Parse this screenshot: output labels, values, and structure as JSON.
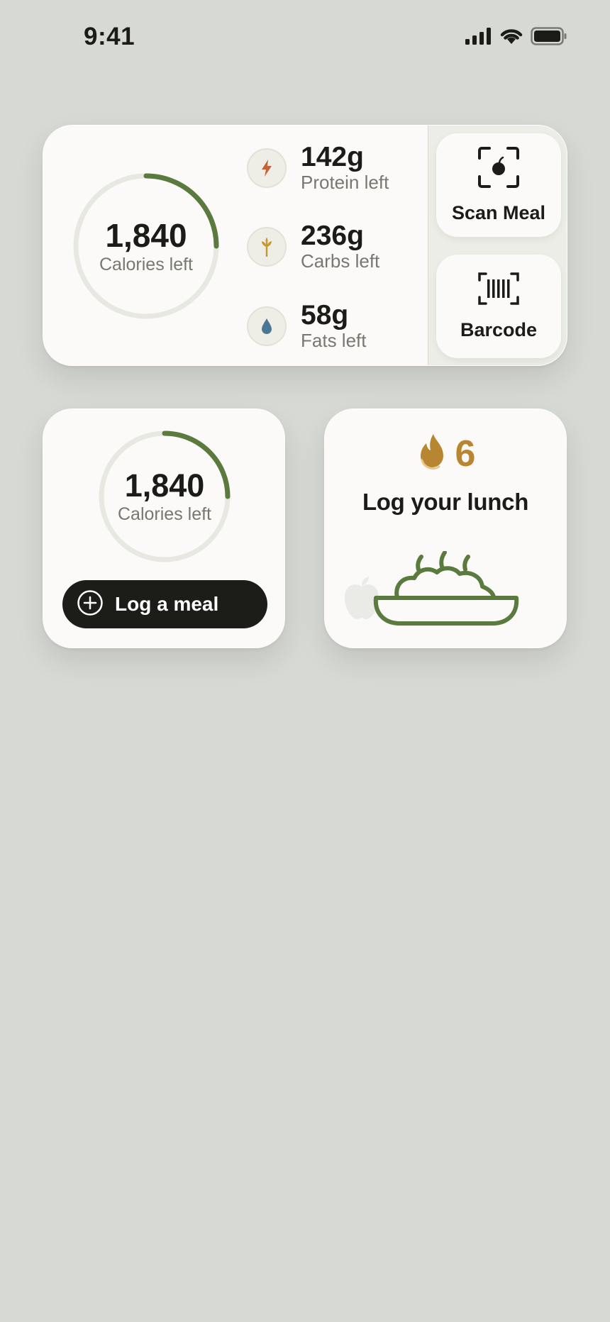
{
  "status_bar": {
    "time": "9:41",
    "icons": [
      "cellular-signal-icon",
      "wifi-icon",
      "battery-icon"
    ]
  },
  "large_widget": {
    "calories": {
      "value": "1,840",
      "label": "Calories left",
      "progress": 0.25
    },
    "macros": [
      {
        "value": "142g",
        "label": "Protein left",
        "icon": "lightning-icon",
        "color": "#c4623a"
      },
      {
        "value": "236g",
        "label": "Carbs left",
        "icon": "wheat-icon",
        "color": "#c69834"
      },
      {
        "value": "58g",
        "label": "Fats left",
        "icon": "drop-icon",
        "color": "#4c7794"
      }
    ],
    "actions": {
      "scan_label": "Scan Meal",
      "barcode_label": "Barcode"
    }
  },
  "calorie_widget": {
    "value": "1,840",
    "label": "Calories left",
    "progress": 0.25,
    "button_label": "Log a meal"
  },
  "lunch_widget": {
    "streak_count": "6",
    "title": "Log your lunch"
  },
  "colors": {
    "accent_green": "#5a7a3e",
    "streak_gold": "#b88630",
    "background": "#d7d9d4",
    "card": "#fbfaf8"
  }
}
